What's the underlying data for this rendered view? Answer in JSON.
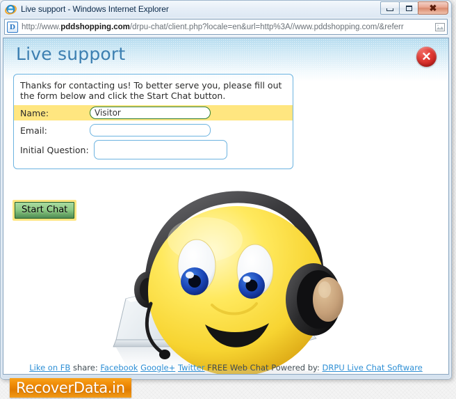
{
  "window": {
    "title": "Live support - Windows Internet Explorer",
    "app_icon": "internet-explorer-icon",
    "minimize_label": "",
    "maximize_label": "",
    "close_label": "✖"
  },
  "address_bar": {
    "favicon_letter": "D",
    "url_prefix": "http://www.",
    "url_host": "pddshopping.com",
    "url_suffix": "/drpu-chat/client.php?locale=en&url=http%3A//www.pddshopping.com/&referr",
    "full_url": "http://www.pddshopping.com/drpu-chat/client.php?locale=en&url=http%3A//www.pddshopping.com/&referr"
  },
  "page": {
    "heading": "Live support",
    "close_button_label": "✕",
    "intro": "Thanks for contacting us! To better serve you, please fill out the form below and click the Start Chat button.",
    "fields": [
      {
        "label": "Name:",
        "value": "Visitor",
        "placeholder": ""
      },
      {
        "label": "Email:",
        "value": "",
        "placeholder": ""
      },
      {
        "label": "Initial Question:",
        "value": "",
        "placeholder": ""
      }
    ],
    "start_button": "Start Chat"
  },
  "footer": {
    "like_label": "Like on FB",
    "share_label": " share: ",
    "facebook": "Facebook",
    "google_plus": "Google+",
    "twitter": "Twitter",
    "powered_label": " FREE Web Chat Powered by: ",
    "powered_link": "DRPU Live Chat Software"
  },
  "banner": {
    "text": "RecoverData.in"
  },
  "colors": {
    "heading": "#3c7fb1",
    "field_highlight": "#ffe680",
    "link": "#2d8fd5",
    "banner": "#ef8a06",
    "close_red": "#c21d1a",
    "panel_border": "#6cb3e0"
  }
}
